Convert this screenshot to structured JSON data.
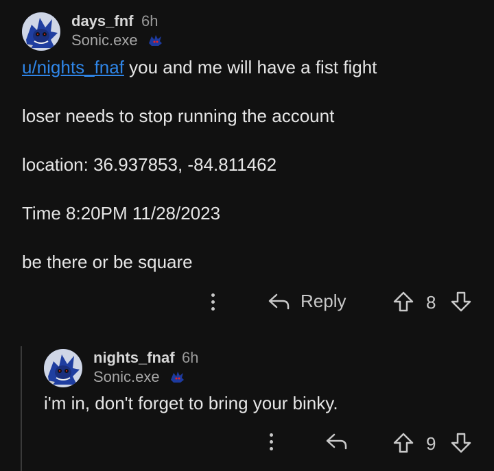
{
  "comment": {
    "username": "days_fnf",
    "time": "6h",
    "flair": "Sonic.exe",
    "mention": "u/nights_fnaf",
    "line1_rest": " you and me will have a fist fight",
    "line2": "loser needs to stop running the account",
    "line3": "location: 36.937853, -84.811462",
    "line4": "Time 8:20PM 11/28/2023",
    "line5": "be there or be square",
    "reply_label": "Reply",
    "score": "8"
  },
  "reply": {
    "username": "nights_fnaf",
    "time": "6h",
    "flair": "Sonic.exe",
    "body": "i'm in, don't forget to bring your binky.",
    "score": "9"
  },
  "colors": {
    "background": "#111111",
    "mention": "#2f86e8",
    "text": "#e6e6e6"
  },
  "icons": [
    "avatar-sonic-exe",
    "flair-sonic-icon",
    "more-dots-icon",
    "reply-arrow-icon",
    "upvote-icon",
    "downvote-icon"
  ]
}
